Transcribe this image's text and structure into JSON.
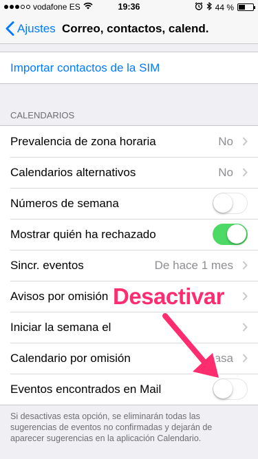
{
  "status_bar": {
    "carrier": "vodafone ES",
    "time": "19:36",
    "battery_percent": "44 %",
    "battery_level": 0.44
  },
  "nav": {
    "back_label": "Ajustes",
    "title": "Correo, contactos, calend."
  },
  "import_sim": {
    "label": "Importar contactos de la SIM"
  },
  "calendars": {
    "header": "CALENDARIOS",
    "rows": [
      {
        "label": "Prevalencia de zona horaria",
        "value": "No"
      },
      {
        "label": "Calendarios alternativos",
        "value": "No"
      },
      {
        "label": "Números de semana",
        "toggle": false
      },
      {
        "label": "Mostrar quién ha rechazado",
        "toggle": true
      },
      {
        "label": "Sincr. eventos",
        "value": "De hace 1 mes"
      },
      {
        "label": "Avisos por omisión"
      },
      {
        "label": "Iniciar la semana el"
      },
      {
        "label": "Calendario por omisión",
        "value": "Casa"
      },
      {
        "label": "Eventos encontrados en Mail",
        "toggle": false
      }
    ],
    "footer": "Si desactivas esta opción, se eliminarán todas las sugerencias de eventos no confirmadas y dejarán de aparecer sugerencias en la aplicación Calendario."
  },
  "annotation": {
    "label": "Desactivar",
    "color": "#ff2d6f"
  },
  "colors": {
    "accent": "#007aff",
    "toggle_on": "#4cd964",
    "background": "#efeff4"
  }
}
